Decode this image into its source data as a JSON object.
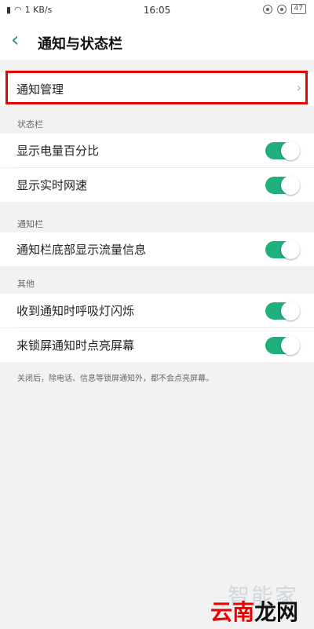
{
  "status_bar": {
    "speed": "1 KB/s",
    "time": "16:05",
    "battery": "47"
  },
  "header": {
    "title": "通知与状态栏"
  },
  "notification_management": {
    "label": "通知管理"
  },
  "sections": {
    "status_bar": {
      "title": "状态栏",
      "items": [
        {
          "label": "显示电量百分比",
          "enabled": true
        },
        {
          "label": "显示实时网速",
          "enabled": true
        }
      ]
    },
    "notification_bar": {
      "title": "通知栏",
      "items": [
        {
          "label": "通知栏底部显示流量信息",
          "enabled": true
        }
      ]
    },
    "other": {
      "title": "其他",
      "items": [
        {
          "label": "收到通知时呼吸灯闪烁",
          "enabled": true
        },
        {
          "label": "来锁屏通知时点亮屏幕",
          "enabled": true
        }
      ]
    }
  },
  "footer_note": "关闭后，除电话、信息等锁屏通知外，都不会点亮屏幕。",
  "watermark": {
    "top": "智能家",
    "bottom_red": "云南",
    "bottom_black": "龙网"
  },
  "colors": {
    "accent": "#1fb07c",
    "highlight": "#e00000"
  }
}
